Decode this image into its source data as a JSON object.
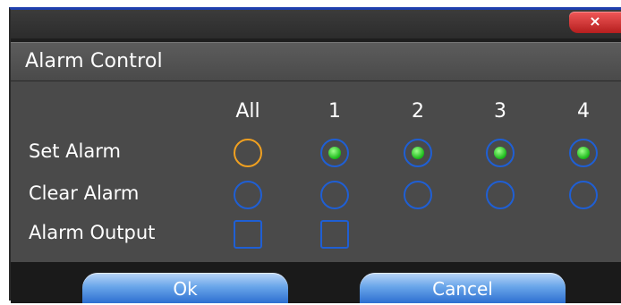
{
  "dialog": {
    "title": "Alarm Control",
    "close_glyph": "×"
  },
  "columns": [
    {
      "label": "All"
    },
    {
      "label": "1"
    },
    {
      "label": "2"
    },
    {
      "label": "3"
    },
    {
      "label": "4"
    }
  ],
  "rows": {
    "set_alarm": {
      "label": "Set Alarm",
      "items": [
        {
          "col": "All",
          "checked": false,
          "highlighted": true
        },
        {
          "col": "1",
          "checked": true
        },
        {
          "col": "2",
          "checked": true
        },
        {
          "col": "3",
          "checked": true
        },
        {
          "col": "4",
          "checked": true
        }
      ]
    },
    "clear_alarm": {
      "label": "Clear Alarm",
      "items": [
        {
          "col": "All",
          "checked": false
        },
        {
          "col": "1",
          "checked": false
        },
        {
          "col": "2",
          "checked": false
        },
        {
          "col": "3",
          "checked": false
        },
        {
          "col": "4",
          "checked": false
        }
      ]
    },
    "alarm_output": {
      "label": "Alarm Output",
      "items": [
        {
          "col": "All",
          "checked": false
        },
        {
          "col": "1",
          "checked": false
        }
      ]
    }
  },
  "buttons": {
    "ok": "Ok",
    "cancel": "Cancel"
  },
  "colors": {
    "radio_border": "#1f5fd4",
    "focus_border": "#f0a020",
    "checked_dot": "#18b818",
    "close_button": "#d83030"
  },
  "icons": {
    "close": "close-icon"
  }
}
